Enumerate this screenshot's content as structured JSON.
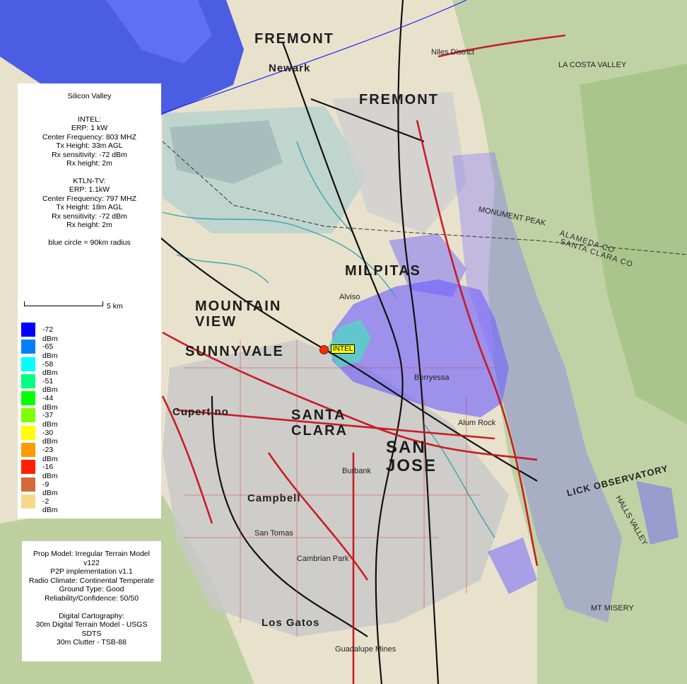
{
  "map": {
    "place_labels": {
      "fremont_north": "FREMONT",
      "newark": "Newark",
      "fremont_south": "FREMONT",
      "niles": "Niles District",
      "milpitas": "MILPITAS",
      "mountain_view": "MOUNTAIN VIEW",
      "sunnyvale": "SUNNYVALE",
      "santa_clara": "SANTA CLARA",
      "san_jose": "SAN JOSE",
      "cupertino": "Cupertino",
      "campbell": "Campbell",
      "los_gatos": "Los Gatos",
      "alum_rock": "Alum Rock",
      "berryessa": "Berryessa",
      "alviso": "Alviso",
      "burbank": "Burbank",
      "lick_observatory": "LICK OBSERVATORY",
      "alameda_co": "ALAMEDA CO",
      "santa_clara_co": "SANTA CLARA CO",
      "monument_peak": "MONUMENT PEAK",
      "mt_misery": "MT MISERY",
      "halls_valley": "HALLS VALLEY",
      "la_costa_valley": "LA COSTA VALLEY",
      "cambrian_park": "Cambrian Park",
      "san_tomas": "San Tomas",
      "guadalupe_mines": "Guadalupe Mines"
    },
    "transmitter": {
      "label": "INTEL"
    },
    "colors": {
      "coverage": "#6a5cff",
      "bay_water": "#3a4fe6",
      "red_roads": "#c8141e",
      "urban_gray": "#c9c9c9"
    }
  },
  "info": {
    "title": "Silicon Valley",
    "tx1": {
      "name": "INTEL:",
      "erp": "ERP: 1 kW",
      "freq": "Center Frequency: 803 MHZ",
      "height": "Tx Height: 33m AGL",
      "rx_sens": "Rx sensitivity: -72 dBm",
      "rx_height": "Rx height: 2m"
    },
    "tx2": {
      "name": "KTLN-TV:",
      "erp": "ERP: 1.1kW",
      "freq": "Center Frequency: 797 MHZ",
      "height": "Tx Height: 18m AGL",
      "rx_sens": "Rx sensitivity: -72 dBm",
      "rx_height": "Rx height: 2m"
    },
    "circle_note": "blue circle = 90km radius",
    "scale_label": "5 km",
    "legend": [
      {
        "label": "-72 dBm",
        "color": "#0000ff"
      },
      {
        "label": "-65 dBm",
        "color": "#0080ff"
      },
      {
        "label": "-58 dBm",
        "color": "#00ffff"
      },
      {
        "label": "-51 dBm",
        "color": "#00ff80"
      },
      {
        "label": "-44 dBm",
        "color": "#00ff00"
      },
      {
        "label": "-37 dBm",
        "color": "#80ff00"
      },
      {
        "label": "-30 dBm",
        "color": "#ffff00"
      },
      {
        "label": "-23 dBm",
        "color": "#ff9900"
      },
      {
        "label": "-16 dBm",
        "color": "#ff2000"
      },
      {
        "label": "-9 dBm",
        "color": "#d46a3a"
      },
      {
        "label": "-2 dBm",
        "color": "#f5d98a"
      }
    ]
  },
  "footer": {
    "lines": [
      "Prop Model: Irregular Terrain Model",
      "v122",
      "P2P implementation v1.1",
      "Radio Climate: Continental Temperate",
      "Ground Type: Good",
      "Reliability/Confidence: 50/50",
      "",
      "Digital Cartography:",
      "30m Digital Terrain Model - USGS",
      "SDTS",
      "30m Clutter - TSB-88"
    ]
  }
}
